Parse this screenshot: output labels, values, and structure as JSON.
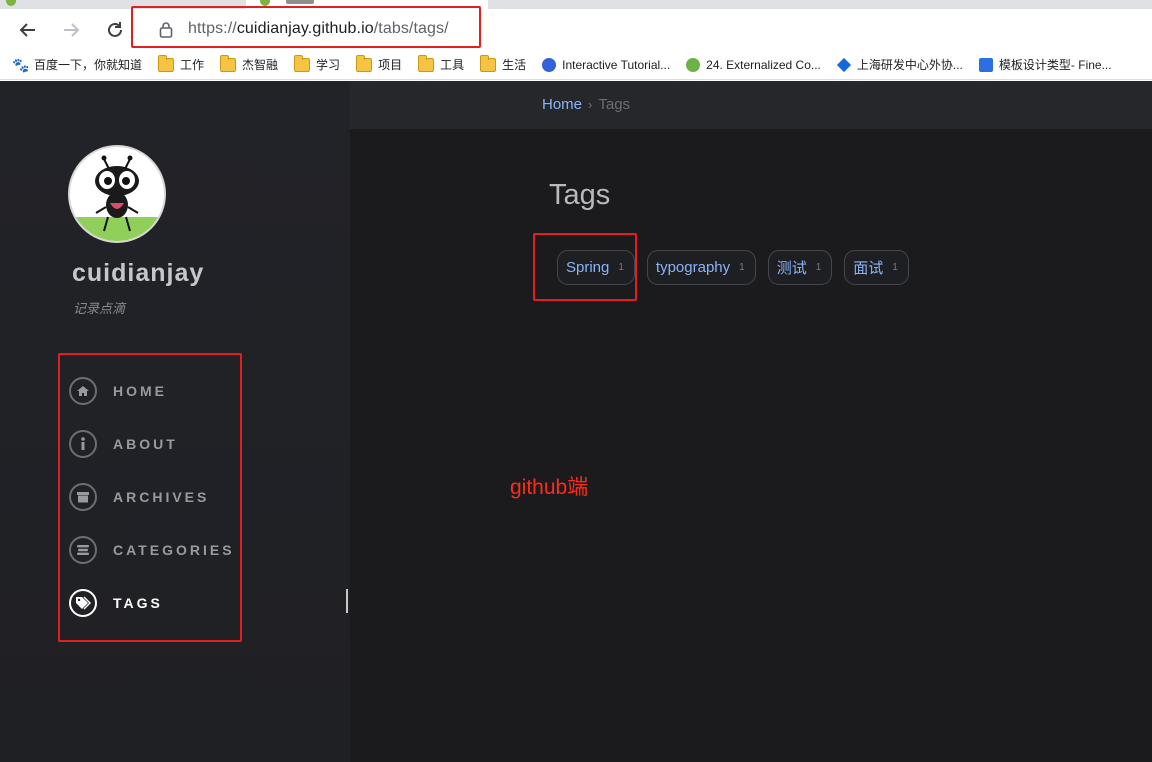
{
  "browser": {
    "url_prefix": "https://",
    "url_host": "cuidianjay.github.io",
    "url_path": "/tabs/tags/"
  },
  "bookmarks": [
    {
      "label": "百度一下，你就知道",
      "icon": "baidu-paw-icon"
    },
    {
      "label": "工作",
      "icon": "folder-icon"
    },
    {
      "label": "杰智融",
      "icon": "folder-icon"
    },
    {
      "label": "学习",
      "icon": "folder-icon"
    },
    {
      "label": "项目",
      "icon": "folder-icon"
    },
    {
      "label": "工具",
      "icon": "folder-icon"
    },
    {
      "label": "生活",
      "icon": "folder-icon"
    },
    {
      "label": "Interactive Tutorial...",
      "icon": "kubernetes-icon"
    },
    {
      "label": "24. Externalized Co...",
      "icon": "spring-leaf-icon"
    },
    {
      "label": "上海研发中心外协...",
      "icon": "jira-diamond-icon"
    },
    {
      "label": "模板设计类型- Fine...",
      "icon": "finereport-icon"
    }
  ],
  "sidebar": {
    "title": "cuidianjay",
    "subtitle": "记录点滴",
    "items": [
      {
        "label": "HOME",
        "icon": "home-icon"
      },
      {
        "label": "ABOUT",
        "icon": "info-icon"
      },
      {
        "label": "ARCHIVES",
        "icon": "archive-icon"
      },
      {
        "label": "CATEGORIES",
        "icon": "stream-icon"
      },
      {
        "label": "TAGS",
        "icon": "tags-icon",
        "active": true
      }
    ]
  },
  "breadcrumb": {
    "home": "Home",
    "separator": "›",
    "current": "Tags"
  },
  "main": {
    "heading": "Tags",
    "tags": [
      {
        "name": "Spring",
        "count": "1"
      },
      {
        "name": "typography",
        "count": "1"
      },
      {
        "name": "测试",
        "count": "1"
      },
      {
        "name": "面试",
        "count": "1"
      }
    ],
    "annotation": "github端"
  },
  "colors": {
    "annotation_red": "#e02020",
    "link_blue": "#8ab4f8",
    "sidebar_bg": "#222328",
    "content_bg": "#1b1b1e"
  }
}
